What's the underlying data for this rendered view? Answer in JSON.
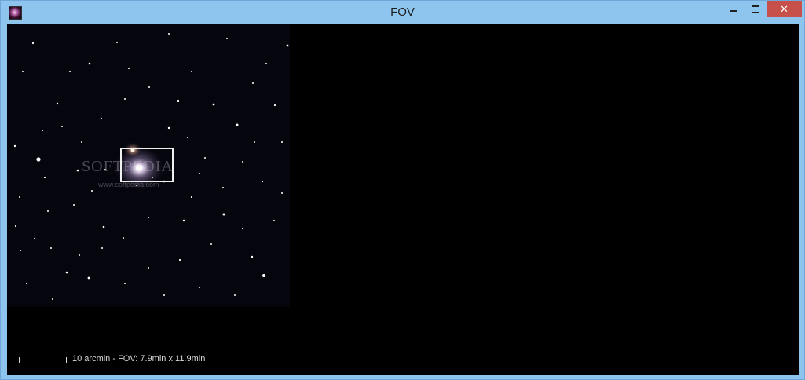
{
  "window": {
    "title": "FOV",
    "close_glyph": "✕"
  },
  "icons": {
    "app": "galaxy-app-icon",
    "minimize": "minimize-icon",
    "maximize": "maximize-icon",
    "close": "close-icon"
  },
  "colors": {
    "titlebar": "#8ec5ef",
    "close_button": "#c7504b",
    "fov_box": "#f0f0f0",
    "background": "#000000"
  },
  "scale": {
    "label": "10 arcmin - FOV: 7.9min x 11.9min"
  },
  "watermark": {
    "brand": "SOFTPEDIA",
    "url": "www.softpedia.com"
  }
}
